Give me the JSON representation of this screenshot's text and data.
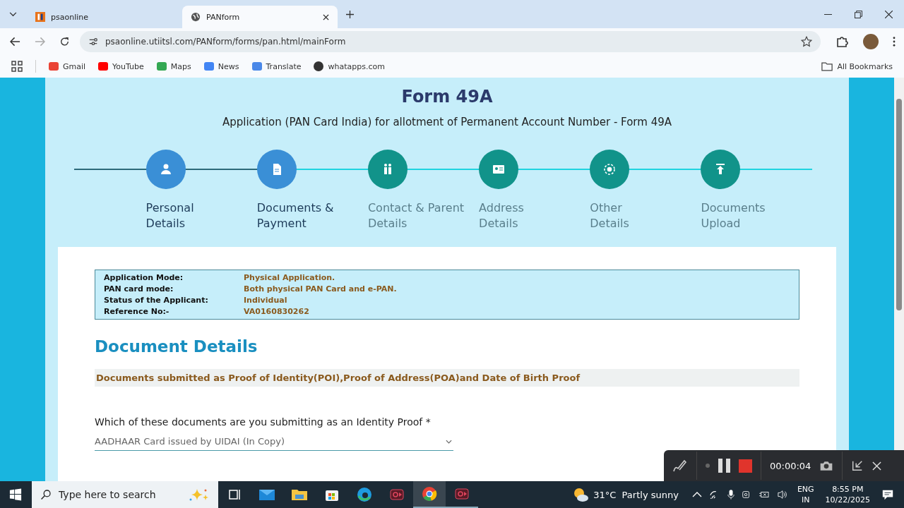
{
  "browser": {
    "tabs": [
      {
        "title": "psaonline",
        "selected": false
      },
      {
        "title": "PANform",
        "selected": true
      }
    ],
    "address": "psaonline.utiitsl.com/PANform/forms/pan.html/mainForm",
    "bookmarks": [
      "Gmail",
      "YouTube",
      "Maps",
      "News",
      "Translate",
      "whatapps.com"
    ],
    "all_bookmarks": "All Bookmarks"
  },
  "page": {
    "title": "Form 49A",
    "subtitle": "Application (PAN Card India) for allotment of Permanent Account Number - Form 49A",
    "steps": [
      {
        "lines": [
          "Personal",
          "Details"
        ],
        "completed": true
      },
      {
        "lines": [
          "Documents &",
          "Payment"
        ],
        "completed": true
      },
      {
        "lines": [
          "Contact & Parent",
          "Details"
        ],
        "completed": false
      },
      {
        "lines": [
          "Address",
          "Details"
        ],
        "completed": false
      },
      {
        "lines": [
          "Other",
          "Details"
        ],
        "completed": false
      },
      {
        "lines": [
          "Documents",
          "Upload"
        ],
        "completed": false
      }
    ],
    "summary": [
      {
        "label": "Application Mode:",
        "value": "Physical Application."
      },
      {
        "label": "PAN card mode:",
        "value": "Both physical PAN Card and e-PAN."
      },
      {
        "label": "Status of the Applicant:",
        "value": "Individual"
      },
      {
        "label": "Reference No:-",
        "value": "VA0160830262"
      }
    ],
    "section_title": "Document Details",
    "notice": "Documents submitted as Proof of Identity(POI),Proof of Address(POA)and Date of Birth Proof",
    "question": "Which of these documents are you submitting as an Identity Proof *",
    "answer": "AADHAAR Card issued by UIDAI (In Copy)"
  },
  "recorder": {
    "timer": "00:00:04"
  },
  "taskbar": {
    "search_placeholder": "Type here to search",
    "weather": "31°C  Partly sunny",
    "language": "ENG",
    "region": "IN",
    "time": "8:55 PM",
    "date": "10/22/2025"
  }
}
